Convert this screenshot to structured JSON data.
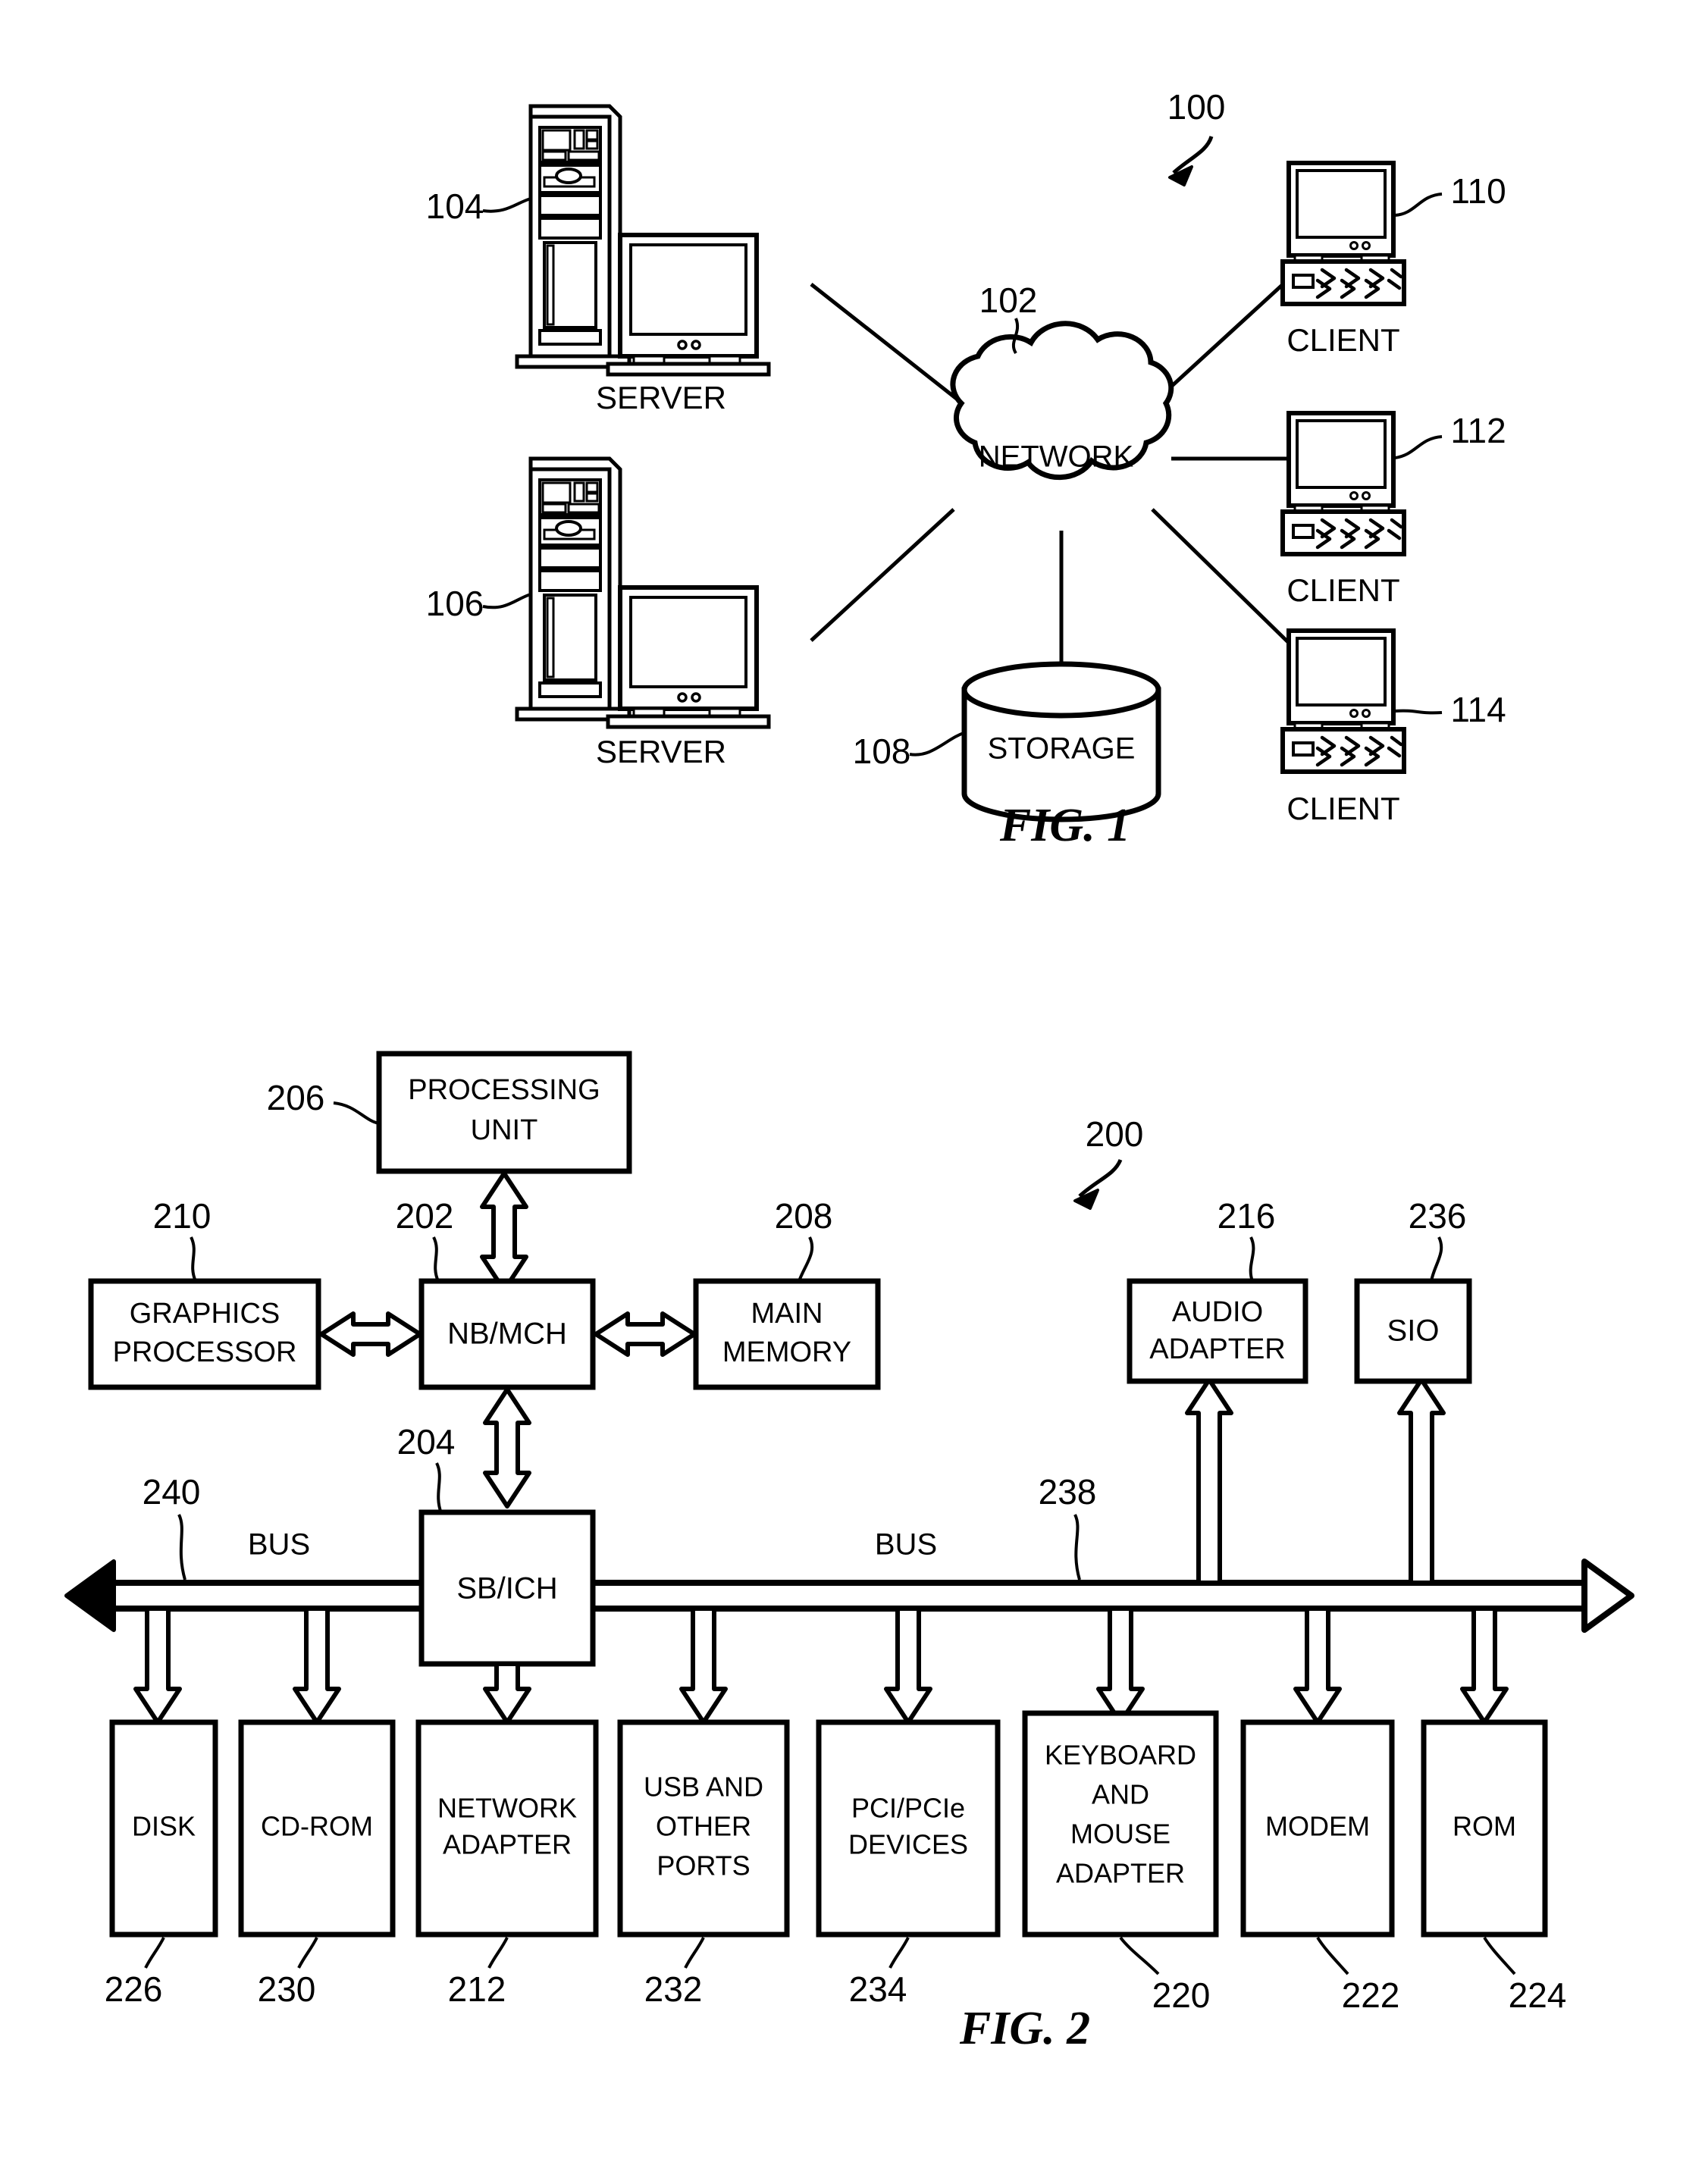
{
  "figure1": {
    "caption": "FIG. 1",
    "system_ref": "100",
    "network": {
      "label": "NETWORK",
      "ref": "102"
    },
    "storage": {
      "label": "STORAGE",
      "ref": "108"
    },
    "servers": [
      {
        "label": "SERVER",
        "ref": "104"
      },
      {
        "label": "SERVER",
        "ref": "106"
      }
    ],
    "clients": [
      {
        "label": "CLIENT",
        "ref": "110"
      },
      {
        "label": "CLIENT",
        "ref": "112"
      },
      {
        "label": "CLIENT",
        "ref": "114"
      }
    ]
  },
  "figure2": {
    "caption": "FIG. 2",
    "system_ref": "200",
    "processing_unit": {
      "label": "PROCESSING UNIT",
      "line1": "PROCESSING",
      "line2": "UNIT",
      "ref": "206"
    },
    "nb_mch": {
      "label": "NB/MCH",
      "ref": "202"
    },
    "sb_ich": {
      "label": "SB/ICH",
      "ref": "204"
    },
    "graphics_processor": {
      "line1": "GRAPHICS",
      "line2": "PROCESSOR",
      "ref": "210"
    },
    "main_memory": {
      "line1": "MAIN",
      "line2": "MEMORY",
      "ref": "208"
    },
    "audio_adapter": {
      "line1": "AUDIO",
      "line2": "ADAPTER",
      "ref": "216"
    },
    "sio": {
      "label": "SIO",
      "ref": "236"
    },
    "bus_left": {
      "label": "BUS",
      "ref": "240"
    },
    "bus_right": {
      "label": "BUS",
      "ref": "238"
    },
    "devices": [
      {
        "lines": [
          "DISK"
        ],
        "ref": "226"
      },
      {
        "lines": [
          "CD-ROM"
        ],
        "ref": "230"
      },
      {
        "lines": [
          "NETWORK",
          "ADAPTER"
        ],
        "ref": "212"
      },
      {
        "lines": [
          "USB AND",
          "OTHER",
          "PORTS"
        ],
        "ref": "232"
      },
      {
        "lines": [
          "PCI/PCIe",
          "DEVICES"
        ],
        "ref": "234"
      },
      {
        "lines": [
          "KEYBOARD",
          "AND",
          "MOUSE",
          "ADAPTER"
        ],
        "ref": "220"
      },
      {
        "lines": [
          "MODEM"
        ],
        "ref": "222"
      },
      {
        "lines": [
          "ROM"
        ],
        "ref": "224"
      }
    ]
  },
  "colors": {
    "ink": "#000000",
    "paper": "#ffffff"
  }
}
